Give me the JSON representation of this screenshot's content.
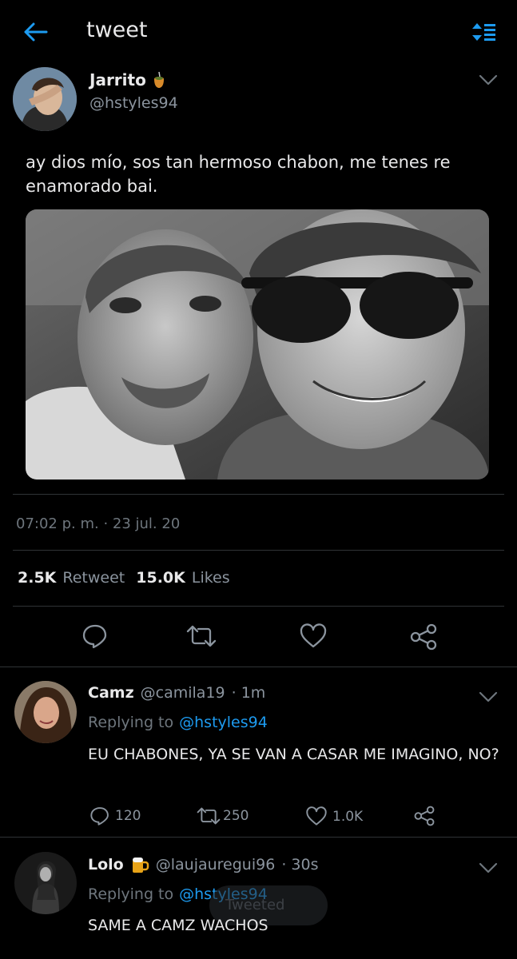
{
  "header": {
    "title": "tweet"
  },
  "tweet": {
    "name": "Jarrito",
    "handle": "@hstyles94",
    "text": "ay dios mío, sos tan hermoso chabon, me tenes re enamorado bai.",
    "timestamp": "07:02 p. m. · 23 jul. 20",
    "retweet_count": "2.5K",
    "retweet_label": "Retweet",
    "likes_count": "15.0K",
    "likes_label": "Likes"
  },
  "replies": [
    {
      "name": "Camz",
      "handle": "@camila19",
      "time": "· 1m",
      "replying_label": "Replying to",
      "replying_to": "@hstyles94",
      "text": "EU CHABONES, YA SE VAN A CASAR ME IMAGINO, NO?",
      "reply_count": "120",
      "retweet_count": "250",
      "like_count": "1.0K"
    },
    {
      "name": "Lolo",
      "handle": "@laujauregui96",
      "time": "· 30s",
      "replying_label": "Replying to",
      "replying_to": "@hstyles94",
      "text": "SAME A CAMZ WACHOS"
    }
  ],
  "toast": {
    "text": "Tweeted"
  },
  "colors": {
    "accent": "#1d9bf0",
    "background": "#000000",
    "muted": "#6e767d"
  },
  "icons": [
    "back-arrow-icon",
    "sort-icon",
    "mate-icon",
    "chevron-down-icon",
    "reply-icon",
    "retweet-icon",
    "like-icon",
    "share-icon",
    "beer-icon"
  ]
}
